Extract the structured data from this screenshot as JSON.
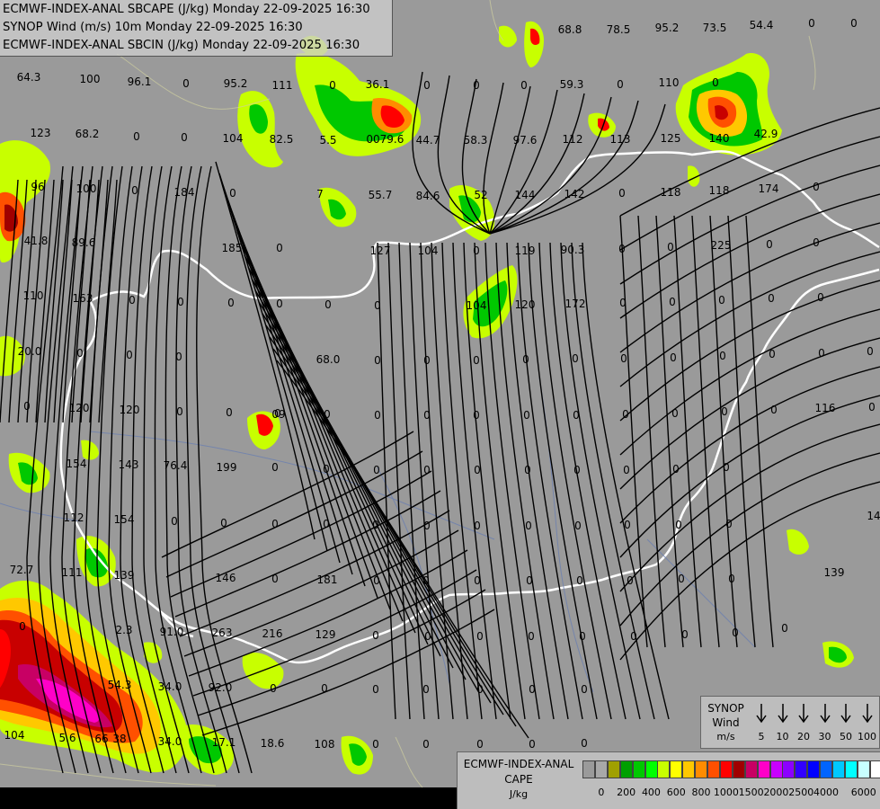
{
  "titles": {
    "line1": "ECMWF-INDEX-ANAL SBCAPE (J/kg) Monday 22-09-2025 16:30",
    "line2": "SYNOP Wind (m/s) 10m Monday 22-09-2025 16:30",
    "line3": "ECMWF-INDEX-ANAL SBCIN (J/kg) Monday 22-09-2025 16:30"
  },
  "colors": {
    "background": "#9a9a9a",
    "border": "#ffffff",
    "streamline": "#000000",
    "cape_scale": [
      "#9a9a9a",
      "#a8a8a8",
      "#a0a000",
      "#00a000",
      "#00c800",
      "#00ff00",
      "#c8ff00",
      "#ffff00",
      "#ffc800",
      "#ff8c00",
      "#ff5000",
      "#ff0000",
      "#a00000",
      "#c80064",
      "#ff00c8",
      "#c800ff",
      "#8c00ff",
      "#3200ff",
      "#0000ff",
      "#0064ff",
      "#00c8ff",
      "#00ffff",
      "#c8ffff",
      "#ffffff"
    ]
  },
  "synop_legend": {
    "title_line1": "SYNOP",
    "title_line2": "Wind",
    "unit": "m/s",
    "speeds": [
      "5",
      "10",
      "20",
      "30",
      "50",
      "100"
    ],
    "icon": "wind-arrow-icon"
  },
  "cape_legend": {
    "title_line1": "ECMWF-INDEX-ANAL",
    "title_line2": "CAPE",
    "unit": "J/kg",
    "ticks": [
      "0",
      "200",
      "400",
      "600",
      "800",
      "1000",
      "1500",
      "2000",
      "2500",
      "4000",
      "6000"
    ]
  },
  "map_labels": [
    "64.3",
    "100",
    "96.1",
    "0",
    "95.2",
    "111",
    "0",
    "36.1",
    "0",
    "0",
    "0",
    "68.8",
    "78.5",
    "95.2",
    "73.5",
    "54.4",
    "0",
    "0",
    "123",
    "68.2",
    "0",
    "0",
    "104",
    "82.5",
    "5.5",
    "00",
    "79.6",
    "44.7",
    "58.3",
    "97.6",
    "112",
    "113",
    "125",
    "140",
    "42.9",
    "59.3",
    "0",
    "110",
    "0",
    "96",
    "100",
    "0",
    "184",
    "0",
    "7",
    "55.7",
    "84.6",
    "52",
    "144",
    "142",
    "0",
    "118",
    "118",
    "174",
    "0",
    "41.8",
    "89.6",
    "185",
    "0",
    "127",
    "104",
    "0",
    "119",
    "90.3",
    "0",
    "0",
    "225",
    "0",
    "0",
    "110",
    "163",
    "0",
    "0",
    "0",
    "0",
    "0",
    "0",
    "104",
    "120",
    "172",
    "0",
    "0",
    "0",
    "0",
    "0",
    "20.0",
    "0",
    "0",
    "0",
    "68.0",
    "0",
    "0",
    "0",
    "0",
    "0",
    "0",
    "0",
    "0",
    "0",
    "0",
    "0",
    "0",
    "120",
    "120",
    "0",
    "0",
    "0",
    "09",
    "0",
    "0",
    "0",
    "0",
    "0",
    "0",
    "0",
    "0",
    "0",
    "0",
    "116",
    "0",
    "154",
    "143",
    "76.4",
    "199",
    "0",
    "0",
    "0",
    "0",
    "0",
    "0",
    "0",
    "0",
    "0",
    "0",
    "112",
    "154",
    "0",
    "0",
    "0",
    "0",
    "0",
    "0",
    "0",
    "0",
    "0",
    "0",
    "0",
    "0",
    "14",
    "72.7",
    "111",
    "139",
    "146",
    "0",
    "181",
    "0",
    "0",
    "0",
    "0",
    "0",
    "0",
    "0",
    "0",
    "139",
    "0",
    "2.3",
    "91.0",
    "263",
    "216",
    "129",
    "0",
    "0",
    "0",
    "0",
    "0",
    "0",
    "0",
    "0",
    "0",
    "54.3",
    "34.0",
    "92.0",
    "0",
    "0",
    "0",
    "0",
    "0",
    "0",
    "0",
    "104",
    "5.6",
    "66",
    "38",
    "34.0",
    "17.1",
    "18.6",
    "108",
    "0",
    "0",
    "0",
    "0",
    "0"
  ]
}
